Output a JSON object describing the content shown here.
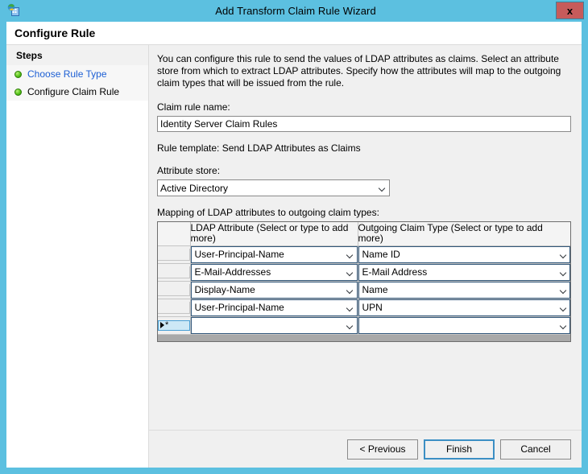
{
  "window": {
    "title": "Add Transform Claim Rule Wizard",
    "icon": "wizard-globe-icon",
    "close_label": "x",
    "titlebar_color": "#5cc0e0",
    "close_button_color": "#c75b5b"
  },
  "page": {
    "header": "Configure Rule"
  },
  "sidebar": {
    "title": "Steps",
    "items": [
      {
        "label": "Choose Rule Type",
        "state": "link",
        "bullet": "green-bullet-icon"
      },
      {
        "label": "Configure Claim Rule",
        "state": "current",
        "bullet": "green-bullet-icon"
      }
    ]
  },
  "main": {
    "description": "You can configure this rule to send the values of LDAP attributes as claims. Select an attribute store from which to extract LDAP attributes. Specify how the attributes will map to the outgoing claim types that will be issued from the rule.",
    "claim_rule_name": {
      "label": "Claim rule name:",
      "value": "Identity Server Claim Rules",
      "placeholder": ""
    },
    "rule_template": "Rule template: Send LDAP Attributes as Claims",
    "attribute_store": {
      "label": "Attribute store:",
      "value": "Active Directory"
    },
    "mapping": {
      "label": "Mapping of LDAP attributes to outgoing claim types:",
      "columns": [
        "",
        "LDAP Attribute (Select or type to add more)",
        "Outgoing Claim Type (Select or type to add more)"
      ],
      "rows": [
        {
          "ldap_attribute": "User-Principal-Name",
          "outgoing_claim_type": "Name ID"
        },
        {
          "ldap_attribute": "E-Mail-Addresses",
          "outgoing_claim_type": "E-Mail Address"
        },
        {
          "ldap_attribute": "Display-Name",
          "outgoing_claim_type": "Name"
        },
        {
          "ldap_attribute": "User-Principal-Name",
          "outgoing_claim_type": "UPN"
        },
        {
          "ldap_attribute": "",
          "outgoing_claim_type": "",
          "new_row": true
        }
      ],
      "new_row_marker": "*"
    }
  },
  "footer": {
    "previous": "< Previous",
    "finish": "Finish",
    "cancel": "Cancel"
  }
}
